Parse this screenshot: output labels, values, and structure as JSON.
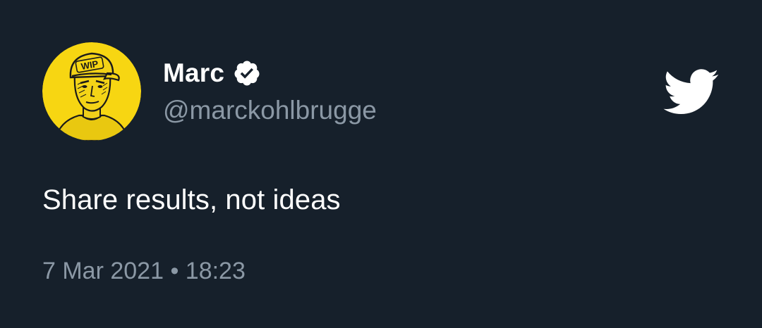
{
  "tweet": {
    "author": {
      "display_name": "Marc",
      "handle": "@marckohlbrugge",
      "verified": true,
      "avatar_cap_text": "WIP"
    },
    "text": "Share results, not ideas",
    "timestamp": "7 Mar 2021 • 18:23"
  },
  "icons": {
    "verified": "verified-badge-icon",
    "brand": "twitter-bird-icon",
    "avatar": "avatar"
  },
  "colors": {
    "background": "#16202b",
    "primary_text": "#ffffff",
    "secondary_text": "#8b98a5",
    "avatar_bg": "#f7d612"
  }
}
